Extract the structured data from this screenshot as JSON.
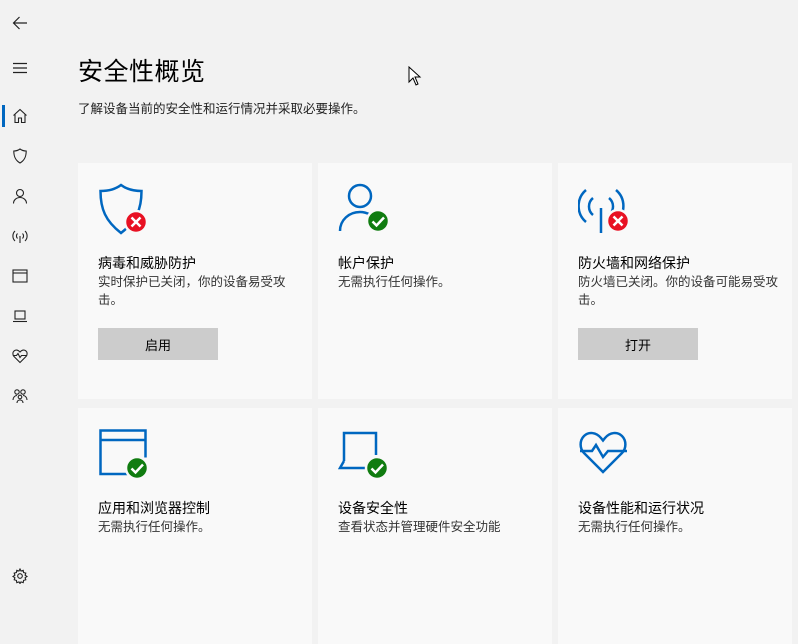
{
  "page": {
    "title": "安全性概览",
    "subtitle": "了解设备当前的安全性和运行情况并采取必要操作。"
  },
  "sidebar": {
    "items": [
      {
        "name": "back",
        "icon": "back-arrow-icon"
      },
      {
        "name": "menu",
        "icon": "hamburger-menu-icon"
      },
      {
        "name": "home",
        "icon": "home-icon"
      },
      {
        "name": "virus",
        "icon": "shield-icon"
      },
      {
        "name": "account",
        "icon": "person-icon"
      },
      {
        "name": "firewall",
        "icon": "wireless-antenna-icon"
      },
      {
        "name": "app-browser",
        "icon": "browser-window-icon"
      },
      {
        "name": "device-security",
        "icon": "laptop-icon"
      },
      {
        "name": "device-health",
        "icon": "heart-pulse-icon"
      },
      {
        "name": "family",
        "icon": "family-icon"
      },
      {
        "name": "settings",
        "icon": "gear-icon"
      }
    ]
  },
  "cards": [
    {
      "title": "病毒和威胁防护",
      "desc": "实时保护已关闭，你的设备易受攻击。",
      "status": "error",
      "button": "启用",
      "icon": "shield-icon"
    },
    {
      "title": "帐户保护",
      "desc": "无需执行任何操作。",
      "status": "ok",
      "icon": "person-icon"
    },
    {
      "title": "防火墙和网络保护",
      "desc": "防火墙已关闭。你的设备可能易受攻击。",
      "status": "error",
      "button": "打开",
      "icon": "wireless-antenna-icon"
    },
    {
      "title": "应用和浏览器控制",
      "desc": "无需执行任何操作。",
      "status": "ok",
      "icon": "browser-window-icon"
    },
    {
      "title": "设备安全性",
      "desc": "查看状态并管理硬件安全功能",
      "status": "ok",
      "icon": "laptop-icon"
    },
    {
      "title": "设备性能和运行状况",
      "desc": "无需执行任何操作。",
      "status": "none",
      "icon": "heart-pulse-icon"
    }
  ],
  "colors": {
    "accent": "#0067c0",
    "error": "#e81123",
    "ok": "#107c10",
    "card_bg": "#f9f9f9",
    "page_bg": "#f2f2f2",
    "button_bg": "#cccccc"
  }
}
